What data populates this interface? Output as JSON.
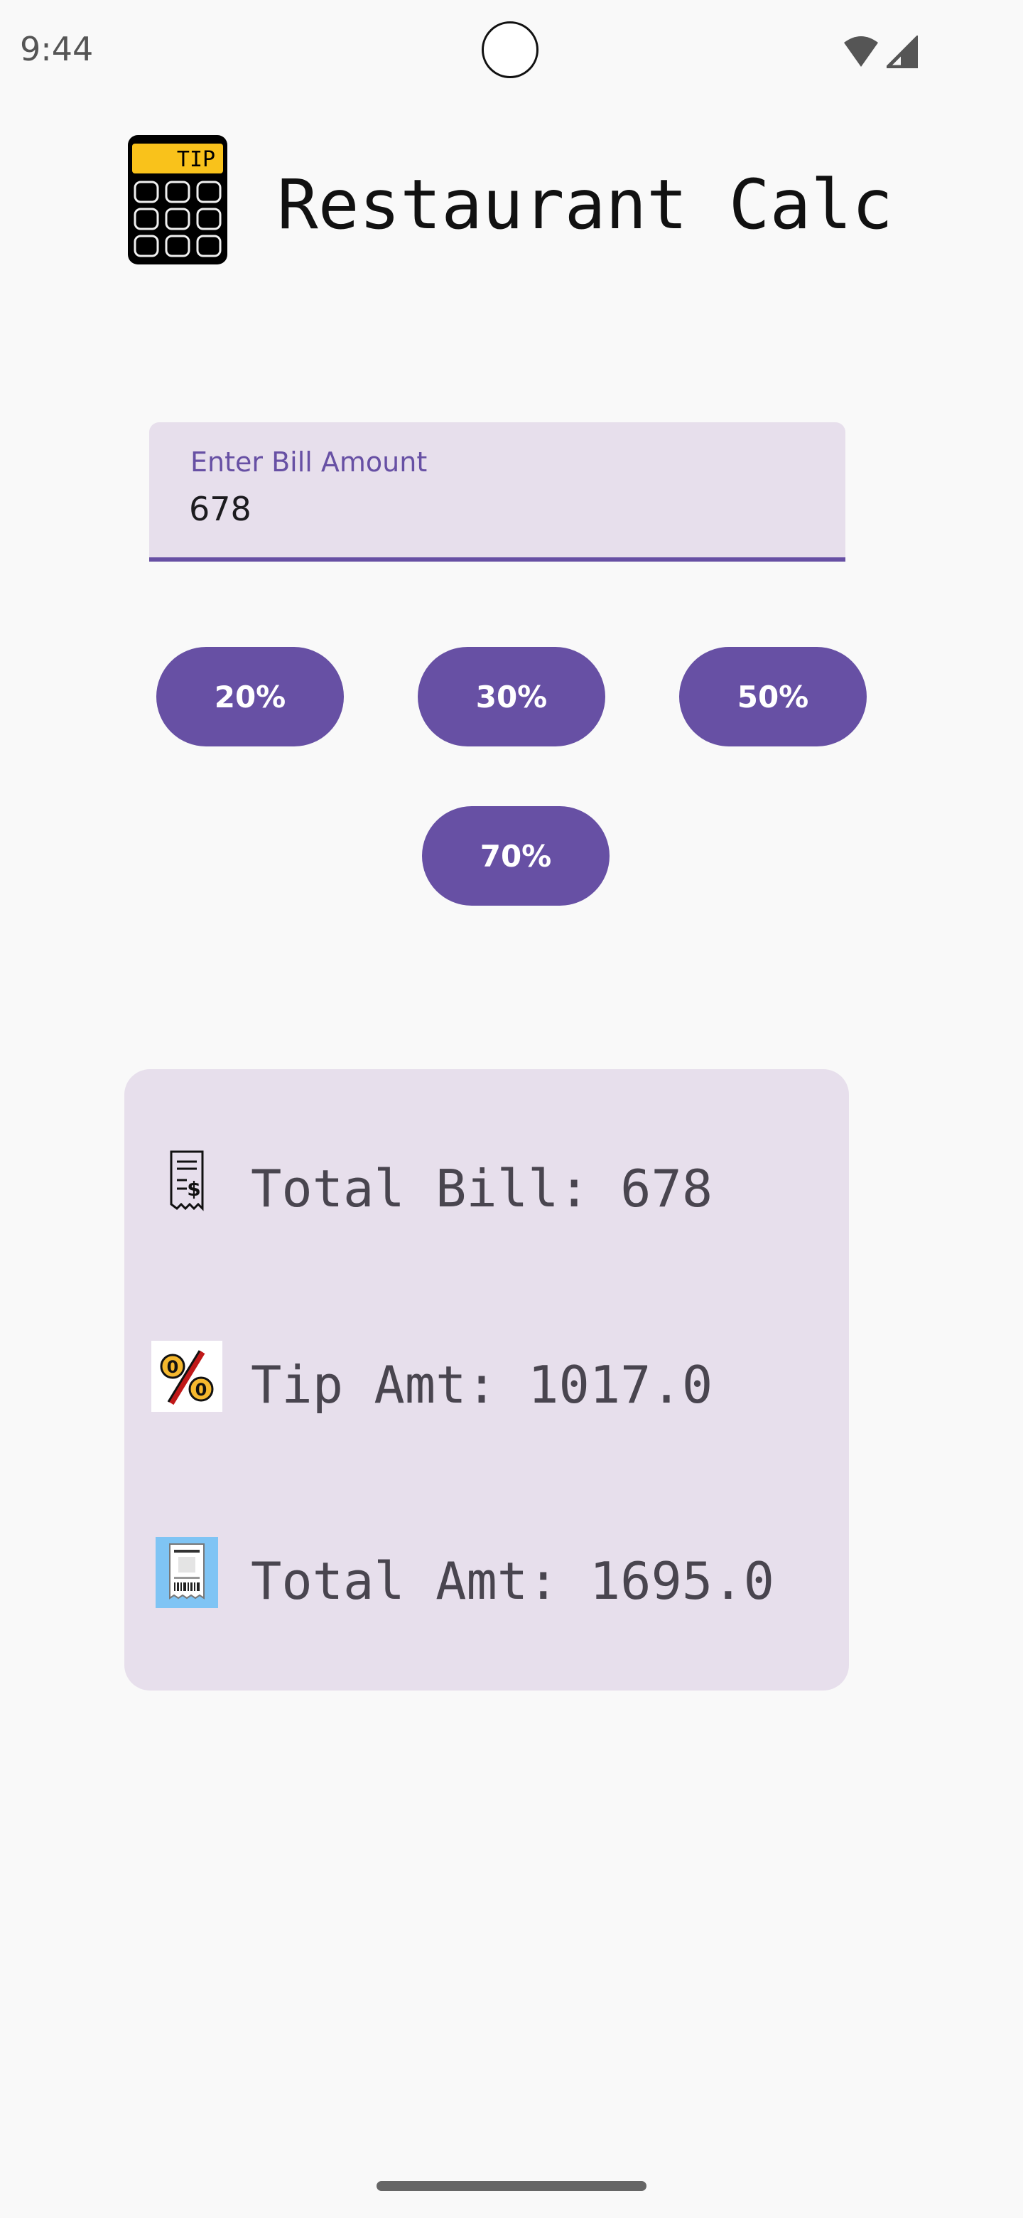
{
  "status_bar": {
    "time": "9:44"
  },
  "app": {
    "title": "Restaurant Calc",
    "logo_text": "TIP"
  },
  "bill_input": {
    "label": "Enter Bill Amount",
    "value": "678"
  },
  "tip_buttons": [
    {
      "label": "20%"
    },
    {
      "label": "30%"
    },
    {
      "label": "50%"
    },
    {
      "label": "70%"
    }
  ],
  "results": {
    "total_bill": "Total Bill: 678",
    "tip_amount": "Tip Amt: 1017.0",
    "total_amount": "Total Amt: 1695.0"
  },
  "icons": {
    "bill": "receipt-dollar-icon",
    "tip": "percent-coins-icon",
    "total": "receipt-icon"
  },
  "colors": {
    "accent": "#6750a4",
    "surface_variant": "#e7dfec",
    "background": "#f9f9f9",
    "logo_yellow": "#f9c21b"
  }
}
